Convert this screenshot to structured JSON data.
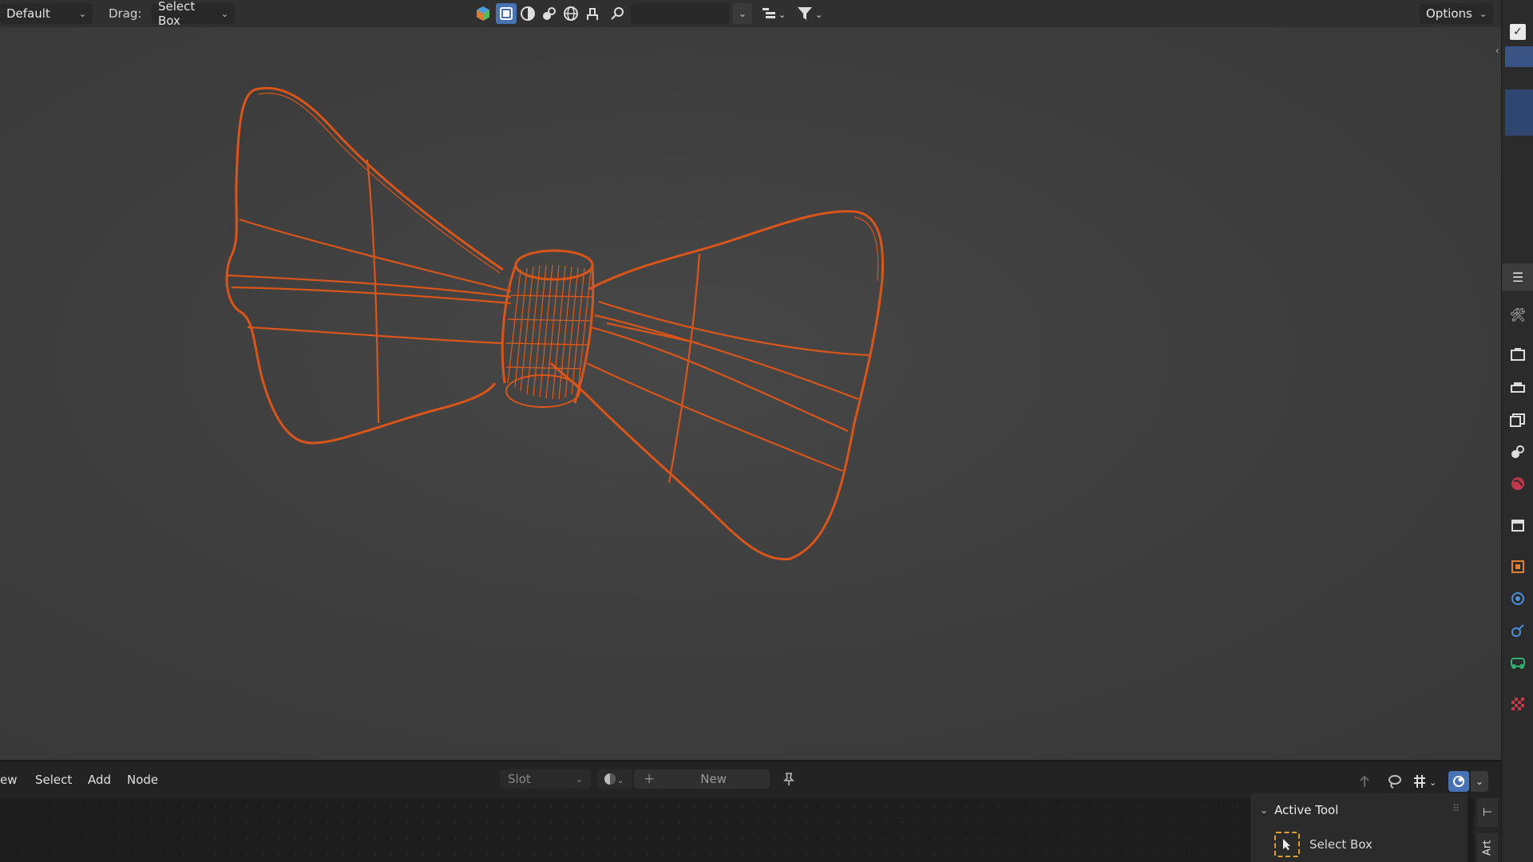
{
  "header": {
    "workspace_dropdown": "Default",
    "drag_label": "Drag:",
    "drag_dropdown": "Select Box",
    "options_label": "Options"
  },
  "node_editor": {
    "menus": [
      "ew",
      "Select",
      "Add",
      "Node"
    ],
    "slot_label": "Slot",
    "new_label": "New"
  },
  "active_tool": {
    "title": "Active Tool",
    "tool_name": "Select Box"
  },
  "side_tab_label": "Art",
  "colors": {
    "accent": "#4772b3",
    "wireframe": "#e0581a",
    "viewport_bg": "#3d3d3d"
  },
  "icons": {
    "header": [
      "object-type-icon",
      "select-box-mode-icon",
      "shading-icon",
      "material-icon",
      "world-icon",
      "brush-icon",
      "search-icon",
      "view-layer-icon",
      "filter-icon"
    ],
    "properties": [
      "tool-icon",
      "render-icon",
      "output-icon",
      "view-layer-icon",
      "scene-icon",
      "world-icon",
      "collection-icon",
      "object-icon",
      "modifiers-icon",
      "physics-icon",
      "constraints-icon",
      "data-icon",
      "texture-icon"
    ]
  }
}
